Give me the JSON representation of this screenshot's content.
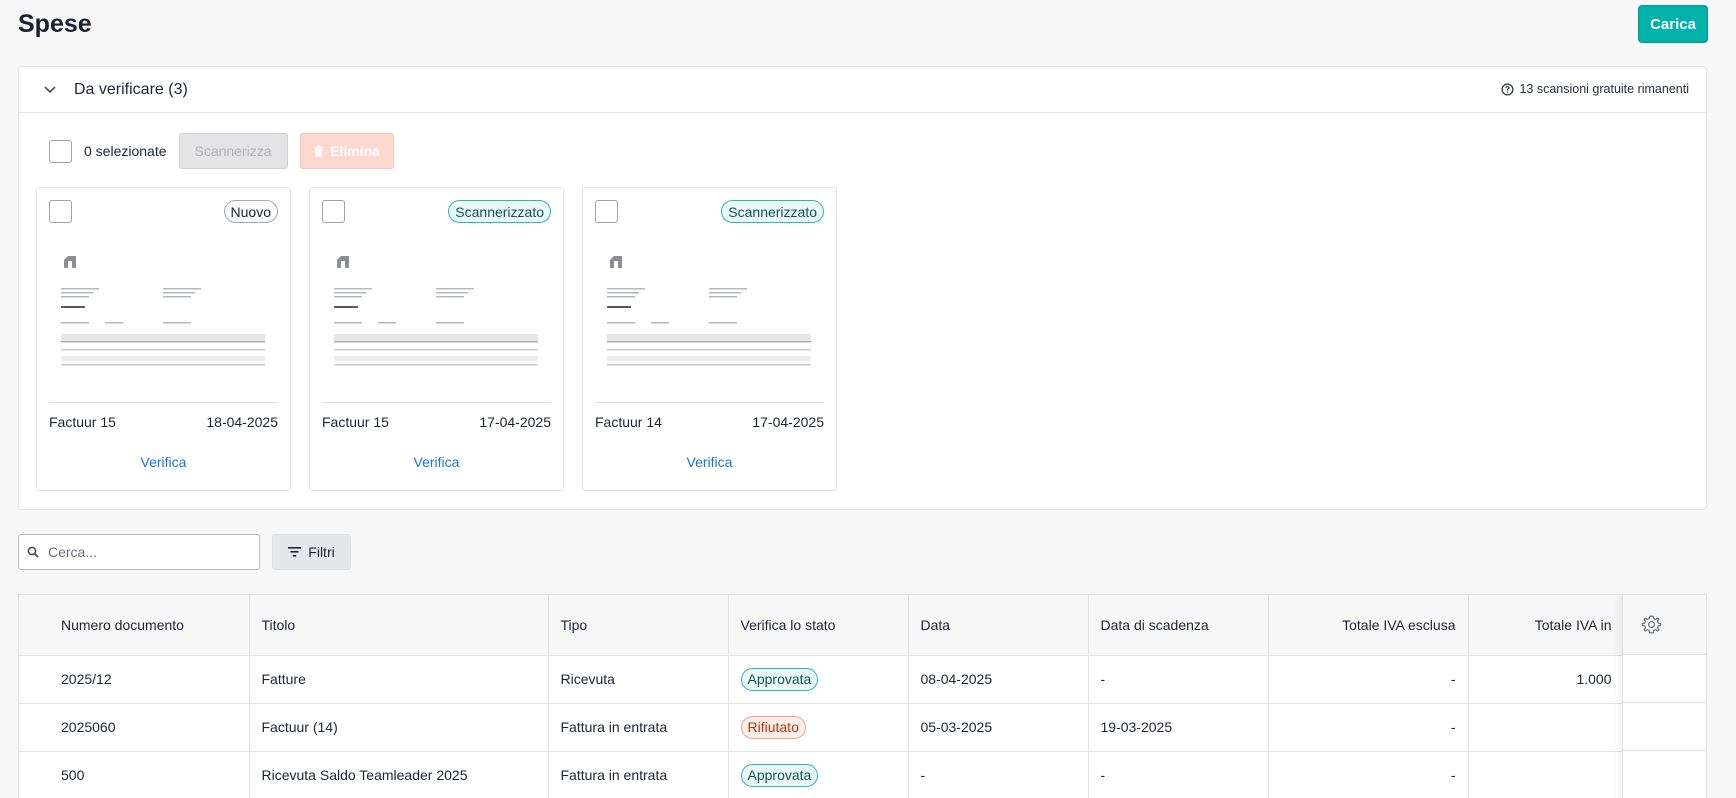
{
  "page": {
    "title": "Spese",
    "upload_label": "Carica"
  },
  "review_panel": {
    "title": "Da verificare (3)",
    "scan_info": "13 scansioni gratuite rimanenti",
    "selected_label": "0 selezionate",
    "scan_button": "Scannerizza",
    "delete_button": "Elimina",
    "cards": [
      {
        "badge": "Nuovo",
        "badge_type": "new",
        "name": "Factuur 15",
        "date": "18-04-2025",
        "action": "Verifica"
      },
      {
        "badge": "Scannerizzato",
        "badge_type": "scanned",
        "name": "Factuur 15",
        "date": "17-04-2025",
        "action": "Verifica"
      },
      {
        "badge": "Scannerizzato",
        "badge_type": "scanned",
        "name": "Factuur 14",
        "date": "17-04-2025",
        "action": "Verifica"
      }
    ]
  },
  "search": {
    "placeholder": "Cerca...",
    "filter_label": "Filtri"
  },
  "table": {
    "columns": [
      "Numero documento",
      "Titolo",
      "Tipo",
      "Verifica lo stato",
      "Data",
      "Data di scadenza",
      "Totale IVA esclusa",
      "Totale IVA in"
    ],
    "rows": [
      [
        "2025/12",
        "Fatture",
        "Ricevuta",
        "Approvata",
        "08-04-2025",
        "-",
        "-",
        "1.000"
      ],
      [
        "2025060",
        "Factuur (14)",
        "Fattura in entrata",
        "Rifiutato",
        "05-03-2025",
        "19-03-2025",
        "-",
        ""
      ],
      [
        "500",
        "Ricevuta Saldo Teamleader 2025",
        "Fattura in entrata",
        "Approvata",
        "-",
        "-",
        "-",
        ""
      ]
    ]
  },
  "colors": {
    "accent": "#00b2a9",
    "link": "#1a73d9",
    "approved": "#33b8b0",
    "rejected": "#f0a58c"
  }
}
